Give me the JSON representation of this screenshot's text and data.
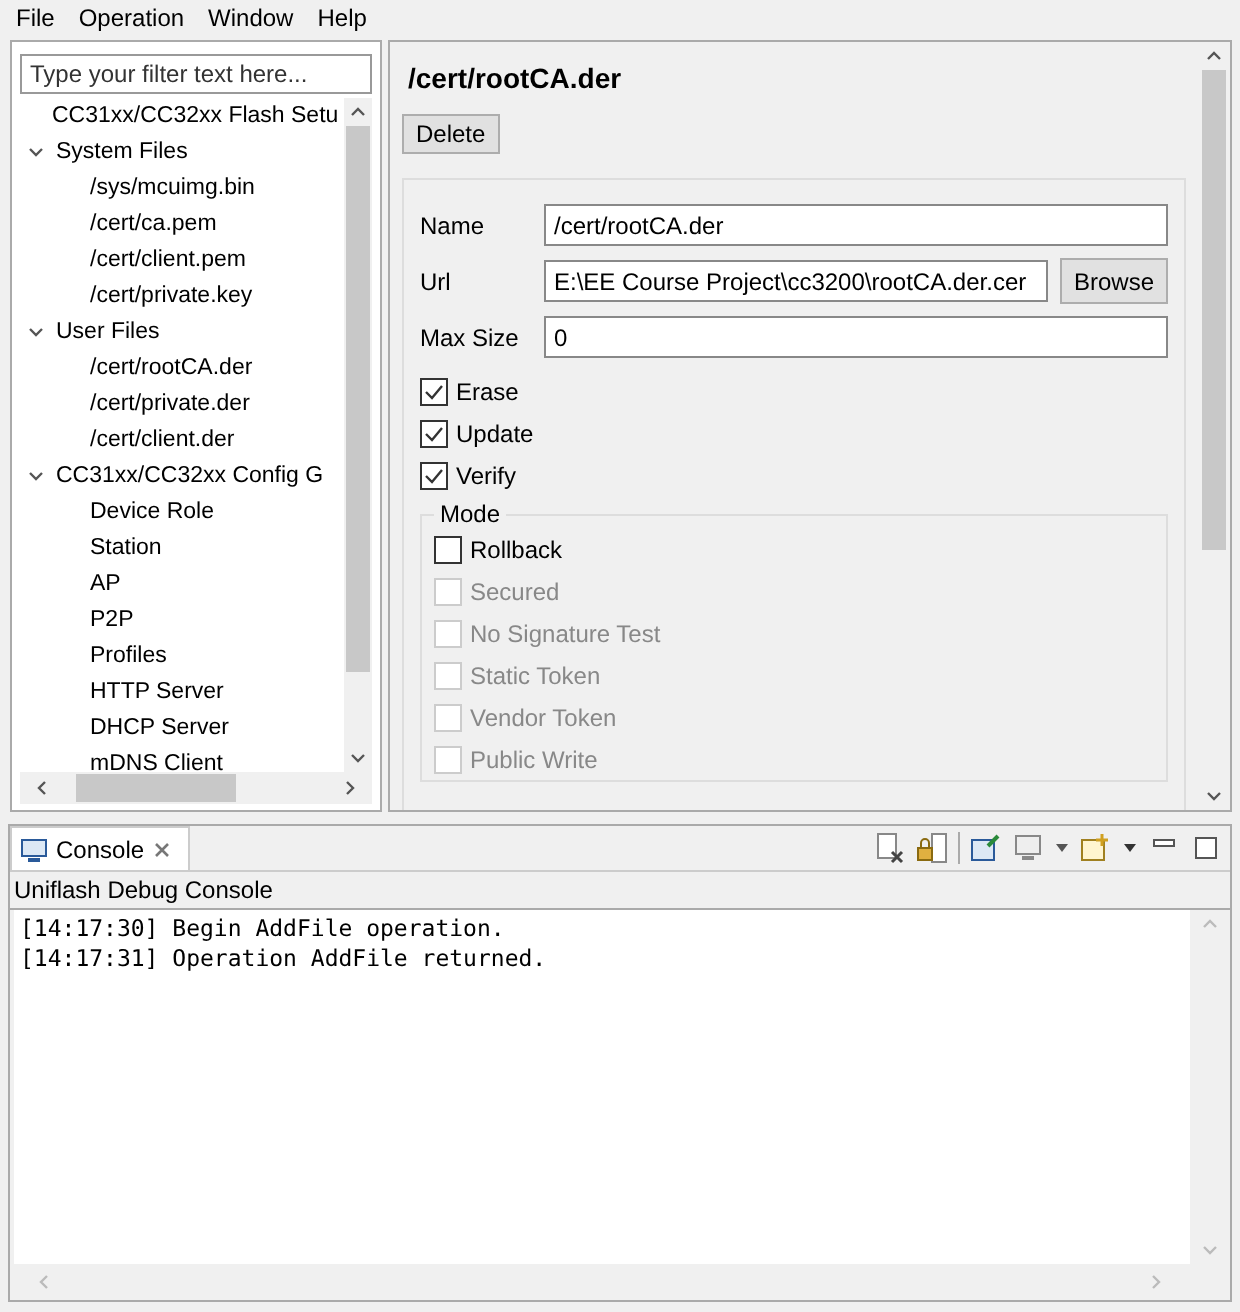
{
  "menu": [
    "File",
    "Operation",
    "Window",
    "Help"
  ],
  "filter": {
    "placeholder": "Type your filter text here..."
  },
  "tree": [
    {
      "label": "CC31xx/CC32xx Flash Setu"
    },
    {
      "label": "System Files",
      "expanded": true,
      "children": [
        {
          "label": "/sys/mcuimg.bin"
        },
        {
          "label": "/cert/ca.pem"
        },
        {
          "label": "/cert/client.pem"
        },
        {
          "label": "/cert/private.key"
        }
      ]
    },
    {
      "label": "User Files",
      "expanded": true,
      "children": [
        {
          "label": "/cert/rootCA.der"
        },
        {
          "label": "/cert/private.der"
        },
        {
          "label": "/cert/client.der"
        }
      ]
    },
    {
      "label": "CC31xx/CC32xx Config G",
      "expanded": true,
      "children": [
        {
          "label": "Device Role"
        },
        {
          "label": "Station"
        },
        {
          "label": "AP"
        },
        {
          "label": "P2P"
        },
        {
          "label": "Profiles"
        },
        {
          "label": "HTTP Server"
        },
        {
          "label": "DHCP Server"
        },
        {
          "label": "mDNS Client"
        }
      ]
    }
  ],
  "detail": {
    "title": "/cert/rootCA.der",
    "delete_button": "Delete",
    "fields": [
      {
        "label": "Name",
        "value": "/cert/rootCA.der"
      },
      {
        "label": "Url",
        "value": "E:\\EE Course Project\\cc3200\\rootCA.der.cer",
        "button": "Browse"
      },
      {
        "label": "Max Size",
        "value": "0"
      }
    ],
    "options": [
      {
        "label": "Erase",
        "checked": true,
        "disabled": false
      },
      {
        "label": "Update",
        "checked": true,
        "disabled": false
      },
      {
        "label": "Verify",
        "checked": true,
        "disabled": false
      }
    ],
    "mode": {
      "label": "Mode",
      "options": [
        {
          "label": "Rollback",
          "checked": false,
          "disabled": false
        },
        {
          "label": "Secured",
          "checked": false,
          "disabled": true
        },
        {
          "label": "No Signature Test",
          "checked": false,
          "disabled": true
        },
        {
          "label": "Static Token",
          "checked": false,
          "disabled": true
        },
        {
          "label": "Vendor Token",
          "checked": false,
          "disabled": true
        },
        {
          "label": "Public Write",
          "checked": false,
          "disabled": true
        }
      ]
    }
  },
  "console": {
    "tab": "Console",
    "title": "Uniflash Debug Console",
    "lines": [
      "[14:17:30] Begin AddFile operation.",
      "[14:17:31] Operation AddFile returned."
    ]
  }
}
